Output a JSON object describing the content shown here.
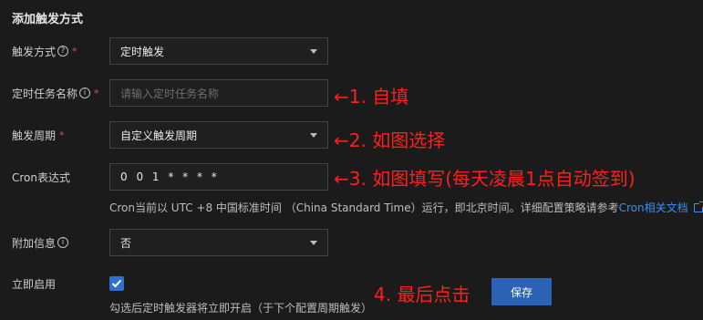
{
  "section": {
    "title": "添加触发方式"
  },
  "trigger_type": {
    "label": "触发方式",
    "required_mark": "*",
    "help_icon": "?",
    "value": "定时触发"
  },
  "task_name": {
    "label": "定时任务名称",
    "required_mark": "*",
    "help_icon": "i",
    "placeholder": "请输入定时任务名称",
    "annotation": "←1. 自填"
  },
  "trigger_period": {
    "label": "触发周期",
    "required_mark": "*",
    "value": "自定义触发周期",
    "annotation": "←2. 如图选择"
  },
  "cron": {
    "label": "Cron表达式",
    "value": "0 0 1 * * * *",
    "annotation": "←3. 如图填写(每天凌晨1点自动签到)",
    "hint_text": "Cron当前以 UTC +8 中国标准时间 （China Standard Time）运行，即北京时间。详细配置策略请参考",
    "hint_link": "Cron相关文档"
  },
  "extra_info": {
    "label": "附加信息",
    "help_icon": "i",
    "value": "否"
  },
  "enable_now": {
    "label": "立即启用",
    "checked": true,
    "hint": "勾选后定时触发器将立即开启（于下个配置周期触发）"
  },
  "save": {
    "annotation": "4. 最后点击",
    "label": "保存"
  },
  "colors": {
    "accent": "#2b62b5",
    "annotation": "#ff1f1f",
    "link": "#3d8ef0",
    "required": "#e34d4d"
  }
}
